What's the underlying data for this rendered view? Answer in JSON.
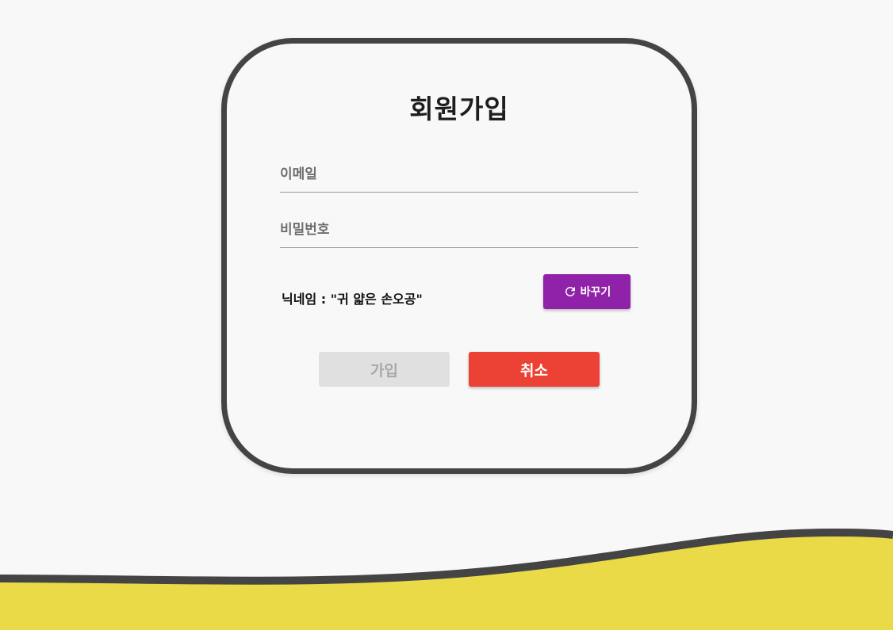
{
  "form": {
    "title": "회원가입",
    "email_placeholder": "이메일",
    "email_value": "",
    "password_placeholder": "비밀번호",
    "password_value": "",
    "nickname_text": "닉네임 : \"귀 얇은 손오공\"",
    "change_label": "바꾸기",
    "join_label": "가입",
    "cancel_label": "취소"
  },
  "icons": {
    "change": "refresh-icon"
  },
  "colors": {
    "background": "#f8f8f8",
    "card_border": "#444444",
    "change_button": "#8f22a8",
    "join_button_disabled": "#e0e0e0",
    "cancel_button": "#ec4235",
    "wave_fill": "#ebda48",
    "wave_stroke": "#444444"
  }
}
